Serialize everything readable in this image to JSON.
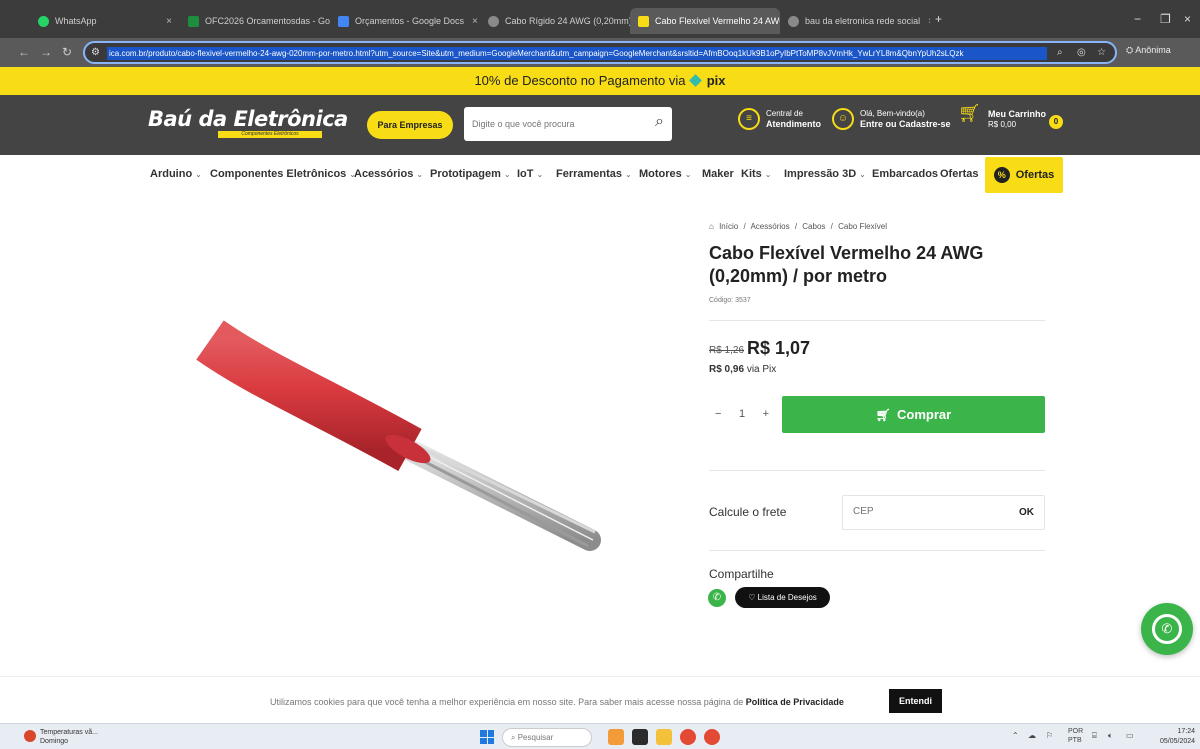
{
  "browser": {
    "tabs": [
      {
        "label": "WhatsApp",
        "color": "#25d366"
      },
      {
        "label": "OFC2026 Orcamentosdas - Go",
        "color": "#1e8e3e"
      },
      {
        "label": "Orçamentos - Google Docs",
        "color": "#4285f4"
      },
      {
        "label": "Cabo Rígido 24 AWG (0,20mm)",
        "color": "#8a8a8a"
      },
      {
        "label": "Cabo Flexível Vermelho 24 AWG",
        "color": "#f7dc16"
      },
      {
        "label": "bau da eletronica rede social",
        "color": "#8a8a8a"
      }
    ],
    "url": "ica.com.br/produto/cabo-flexivel-vermelho-24-awg-020mm-por-metro.html?utm_source=Site&utm_medium=GoogleMerchant&utm_campaign=GoogleMerchant&srsltid=AfmBOoq1kUk9B1oPyIbPtToMP8vJVmHk_YwLrYL8m&QbnYpUh2sLQzk",
    "profile": "Anônima"
  },
  "promo": {
    "text": "10% de Desconto no Pagamento via",
    "pix": "pix"
  },
  "header": {
    "logo": "Baú da Eletrônica",
    "logo_sub": "Componentes Eletrônicos",
    "empresas_button": "Para Empresas",
    "search_placeholder": "Digite o que você procura",
    "atendimento_line1": "Central de",
    "atendimento_line2": "Atendimento",
    "login_line1": "Olá, Bem-vindo(a)",
    "login_line2": "Entre ou Cadastre-se",
    "cart_line1": "Meu Carrinho",
    "cart_line2": "R$ 0,00",
    "cart_count": "0"
  },
  "nav": {
    "items": [
      {
        "label": "Arduino",
        "chevron": true
      },
      {
        "label": "Componentes Eletrônicos",
        "chevron": true
      },
      {
        "label": "Acessórios",
        "chevron": true
      },
      {
        "label": "Prototipagem",
        "chevron": true
      },
      {
        "label": "IoT",
        "chevron": true
      },
      {
        "label": "Ferramentas",
        "chevron": true
      },
      {
        "label": "Motores",
        "chevron": true
      },
      {
        "label": "Maker",
        "chevron": false
      },
      {
        "label": "Kits",
        "chevron": true
      },
      {
        "label": "Impressão 3D",
        "chevron": true
      },
      {
        "label": "Embarcados",
        "chevron": false
      },
      {
        "label": "Ofertas",
        "chevron": false
      }
    ],
    "ofertas_button": "Ofertas"
  },
  "product": {
    "breadcrumb": [
      "Início",
      "/",
      "Acessórios",
      "/",
      "Cabos",
      "/",
      "Cabo Flexível"
    ],
    "title": "Cabo Flexível Vermelho 24 AWG (0,20mm) / por metro",
    "code": "Código: 3537",
    "old_price": "R$ 1,26",
    "price": "R$ 1,07",
    "pix_price": "R$ 0,96",
    "pix_suffix": "via Pix",
    "quantity": "1",
    "qty_minus": "−",
    "qty_plus": "+",
    "buy_button": "Comprar",
    "frete_label": "Calcule o frete",
    "cep_placeholder": "CEP",
    "cep_ok": "OK",
    "share_label": "Compartilhe",
    "wishlist_button": "Lista de Desejos"
  },
  "cookie": {
    "text": "Utilizamos cookies para que você tenha a melhor experiência em nosso site. Para saber mais acesse nossa página de",
    "link": "Política de Privacidade",
    "button": "Entendi"
  },
  "taskbar": {
    "weather_line1": "Temperaturas vã...",
    "weather_line2": "Domingo",
    "search_placeholder": "Pesquisar",
    "lang_line1": "POR",
    "lang_line2": "PTB",
    "time": "17:24",
    "date": "05/05/2024"
  },
  "colors": {
    "accent_yellow": "#f7dc16",
    "header_bg": "#444444",
    "buy_green": "#3bb54a",
    "wire_red": "#d93a3f"
  }
}
